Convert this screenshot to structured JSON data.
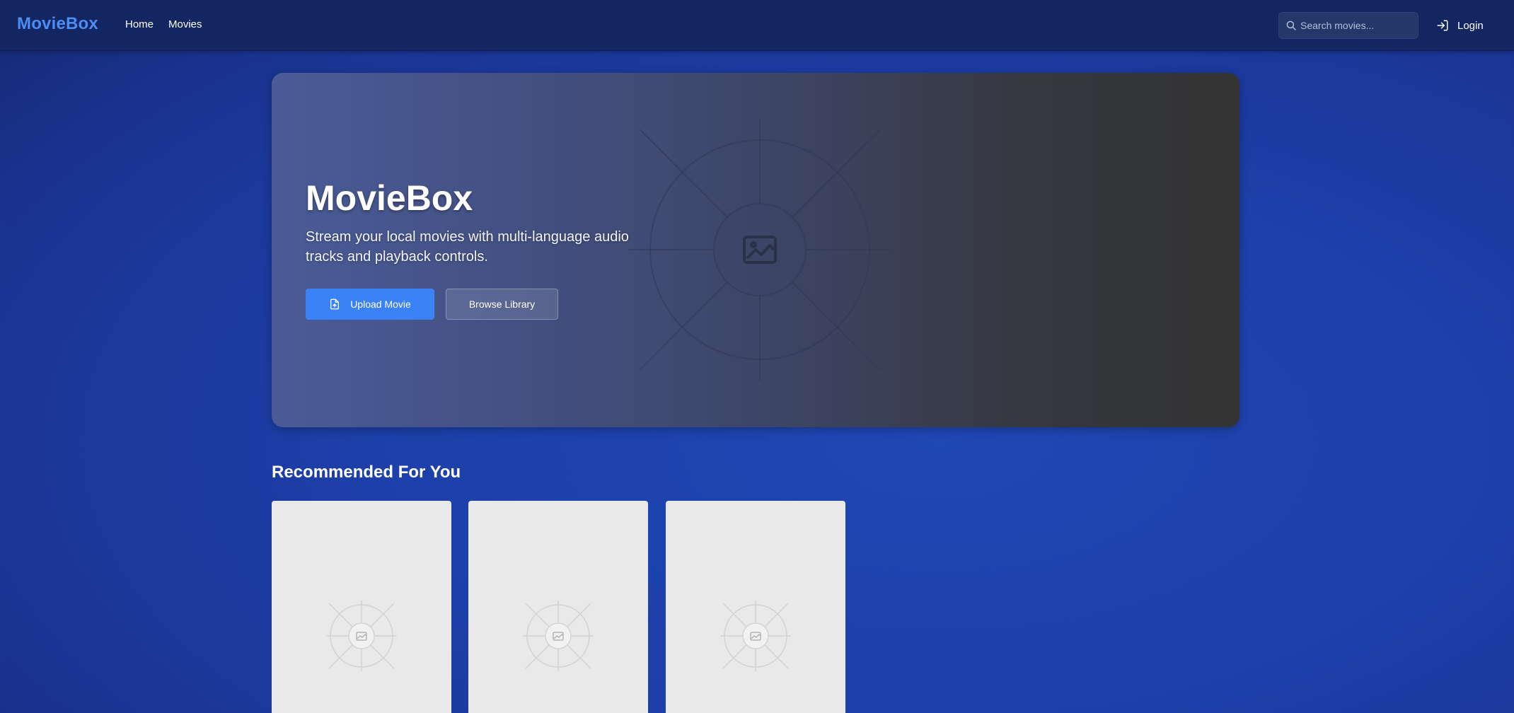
{
  "header": {
    "brand": "MovieBox",
    "nav": [
      {
        "label": "Home"
      },
      {
        "label": "Movies"
      }
    ],
    "search": {
      "placeholder": "Search movies...",
      "value": ""
    },
    "login_label": "Login"
  },
  "hero": {
    "title": "MovieBox",
    "subtitle": "Stream your local movies with multi-language audio tracks and playback controls.",
    "upload_label": "Upload Movie",
    "browse_label": "Browse Library"
  },
  "recommended": {
    "title": "Recommended For You",
    "cards": [
      {
        "icon": "image-placeholder-icon"
      },
      {
        "icon": "image-placeholder-icon"
      },
      {
        "icon": "image-placeholder-icon"
      }
    ]
  },
  "colors": {
    "brand": "#4b8cf5",
    "accent": "#3b82f6",
    "topbar": "#132662",
    "background": "#1d3fa9",
    "card": "#e9e9e9"
  }
}
